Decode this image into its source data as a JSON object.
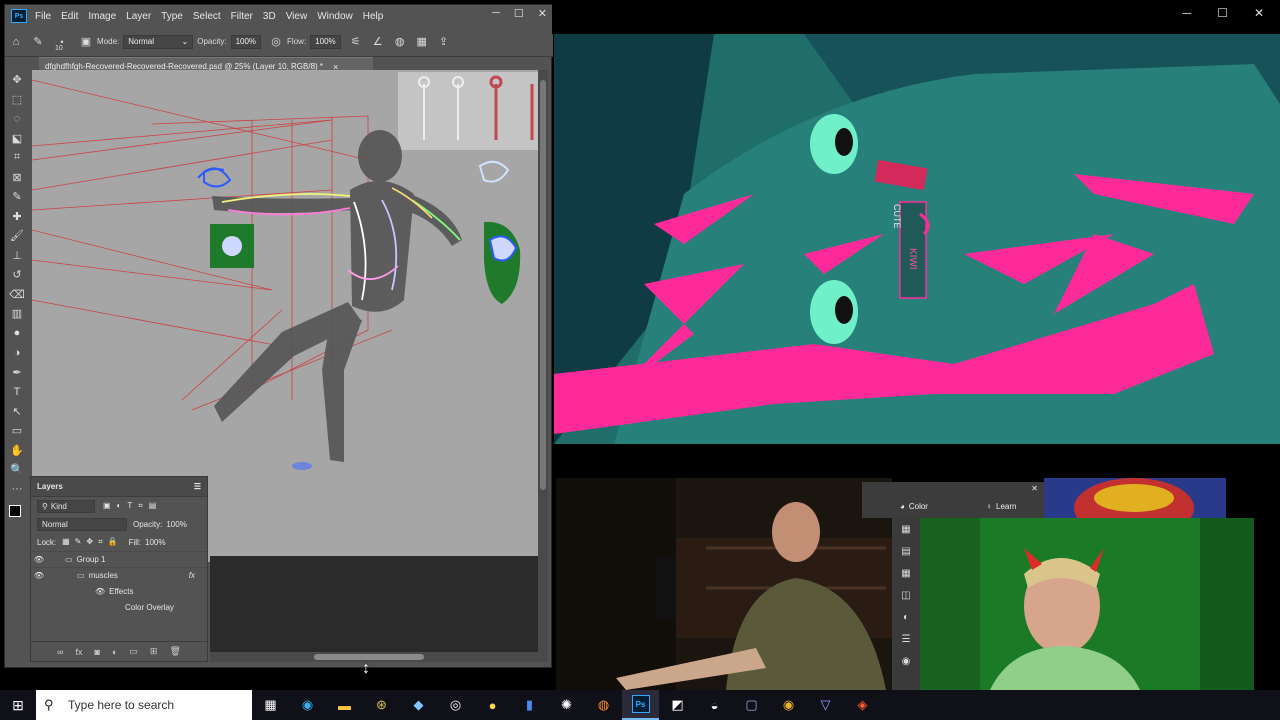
{
  "photoshop": {
    "logo": "Ps",
    "menu": [
      "File",
      "Edit",
      "Image",
      "Layer",
      "Type",
      "Select",
      "Filter",
      "3D",
      "View",
      "Window",
      "Help"
    ],
    "window_controls": {
      "minimize": "─",
      "maximize": "☐",
      "close": "✕"
    },
    "options": {
      "brush_size": "10",
      "mode_label": "Mode:",
      "mode_value": "Normal",
      "opacity_label": "Opacity:",
      "opacity_value": "100%",
      "flow_label": "Flow:",
      "flow_value": "100%"
    },
    "document_tab": {
      "title": "dfghdfhfgh-Recovered-Recovered-Recovered.psd @ 25% (Layer 10, RGB/8) *",
      "close": "×"
    },
    "tools": [
      "move-tool-icon",
      "marquee-tool-icon",
      "lasso-tool-icon",
      "object-select-tool-icon",
      "crop-tool-icon",
      "frame-tool-icon",
      "eyedropper-tool-icon",
      "healing-tool-icon",
      "brush-tool-icon",
      "stamp-tool-icon",
      "history-brush-icon",
      "eraser-tool-icon",
      "gradient-tool-icon",
      "blur-tool-icon",
      "dodge-tool-icon",
      "pen-tool-icon",
      "type-tool-icon",
      "path-select-icon",
      "shape-tool-icon",
      "hand-tool-icon",
      "zoom-tool-icon",
      "more-tools-icon"
    ],
    "tool_glyphs": [
      "✥",
      "⬚",
      "◌",
      "⬕",
      "⌗",
      "⊠",
      "✎",
      "✚",
      "🖌",
      "⊥",
      "↺",
      "⌫",
      "▥",
      "●",
      "◑",
      "✒",
      "T",
      "↖",
      "▭",
      "✋",
      "🔍",
      "···"
    ]
  },
  "layers_panel": {
    "title": "Layers",
    "filter_label": "Kind",
    "blend_mode": "Normal",
    "opacity_label": "Opacity:",
    "opacity_value": "100%",
    "lock_label": "Lock:",
    "fill_label": "Fill:",
    "fill_value": "100%",
    "layers": [
      {
        "name": "Group 1"
      },
      {
        "name": "muscles",
        "fx": "fx"
      },
      {
        "name": "Effects"
      },
      {
        "name": "Color Overlay"
      }
    ]
  },
  "right_window_controls": {
    "minimize": "─",
    "maximize": "☐",
    "close": "✕"
  },
  "anime_frame": {
    "sign_top": "CUTE",
    "sign_bottom": "KIWI"
  },
  "ps_mini": {
    "tab_color": "Color",
    "tab_learn": "Learn"
  },
  "taskbar": {
    "search_placeholder": "Type here to search",
    "apps": [
      "task-view-icon",
      "edge-icon",
      "file-explorer-icon",
      "app-icon-1",
      "app-icon-2",
      "app-icon-3",
      "app-icon-4",
      "docs-icon",
      "app-icon-5",
      "firefox-icon",
      "photoshop-icon",
      "app-icon-6",
      "app-icon-7",
      "app-icon-8",
      "chrome-icon",
      "app-icon-9",
      "brave-icon"
    ],
    "photoshop_label": "Ps"
  },
  "colors": {
    "ps_bg": "#535353",
    "canvas": "#a6a6a6",
    "anime_teal": "#1f6e6a",
    "anime_magenta": "#ff2a9a",
    "green_screen": "#1b7a25"
  }
}
